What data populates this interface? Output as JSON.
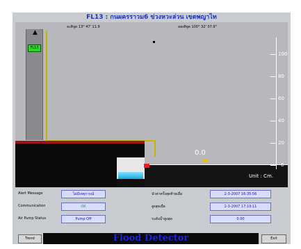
{
  "window": {
    "title": "FL13 : กนผครราวม6 ข่วงหวะล่วน เขตพญาไท"
  },
  "coords": {
    "lat": "ละติจูด 13° 47' 11.9",
    "lon": "ลองติจูด 100° 32' 07.9\""
  },
  "pole_badge": "FL13",
  "level_value": "0.0",
  "scale": {
    "ticks": [
      "100",
      "80",
      "60",
      "40",
      "20",
      "0"
    ],
    "unit": "Unit : Cm."
  },
  "panel": {
    "alert_label": "Alert Message",
    "alert_value": "ไม่มีเหตุการณ์",
    "comm_label": "Communication",
    "comm_value": "OK",
    "pump_label": "Air Pump Status",
    "pump_value": "Pump Off",
    "last_update_label": "นำค่าครั้งสุดท้ายเมื่อ",
    "last_update_value": "2-3-2007 16:35:56",
    "max_label": "สูงสุดเมื่อ",
    "max_value": "2-3-2007 17:19:11",
    "max_level_label": "ระดับน้ำสูงสุด",
    "max_level_value": "0.00"
  },
  "footer": {
    "trend": "Trend",
    "banner": "Flood Detector",
    "exit": "Exit"
  },
  "colors": {
    "accent": "#1c30c8",
    "sensor": "#e82020",
    "marker": "#e8c400",
    "badge": "#22dd22"
  }
}
